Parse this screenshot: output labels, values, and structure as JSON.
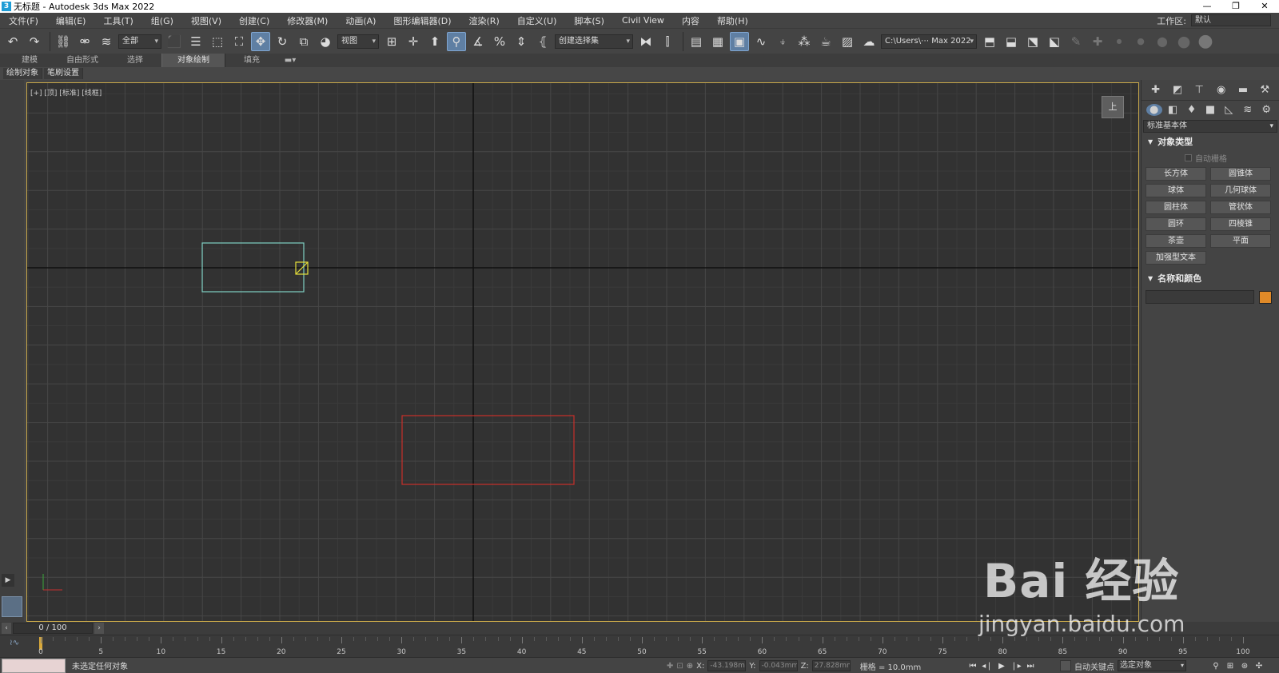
{
  "window": {
    "title": "无标题 - Autodesk 3ds Max 2022",
    "controls": [
      "—",
      "❐",
      "✕"
    ]
  },
  "menu": {
    "items": [
      "文件(F)",
      "编辑(E)",
      "工具(T)",
      "组(G)",
      "视图(V)",
      "创建(C)",
      "修改器(M)",
      "动画(A)",
      "图形编辑器(D)",
      "渲染(R)",
      "自定义(U)",
      "脚本(S)",
      "Civil View",
      "内容",
      "帮助(H)"
    ],
    "workspace_label": "工作区:",
    "workspace_value": "默认"
  },
  "toolbar": {
    "selection_filter": "全部",
    "coord_system": "视图",
    "named_selection": "创建选择集",
    "project_path": "C:\\Users\\⋯ Max 2022"
  },
  "ribbon": {
    "tabs": [
      "建模",
      "自由形式",
      "选择",
      "对象绘制",
      "填充"
    ],
    "active_tab": "对象绘制",
    "panel_items": [
      "绘制对象",
      "笔刷设置"
    ]
  },
  "viewport": {
    "label": "[+] [顶] [标准] [线框]",
    "viewcube_label": "上"
  },
  "command_panel": {
    "category": "标准基本体",
    "object_type_header": "对象类型",
    "autogrid_label": "自动栅格",
    "object_buttons": [
      "长方体",
      "圆锥体",
      "球体",
      "几何球体",
      "圆柱体",
      "管状体",
      "圆环",
      "四棱锥",
      "茶壶",
      "平面",
      "加强型文本"
    ],
    "name_color_header": "名称和颜色",
    "object_color": "#e08a28"
  },
  "timeline": {
    "frame_display": "0 / 100",
    "tick_labels": [
      "0",
      "5",
      "10",
      "15",
      "20",
      "25",
      "30",
      "35",
      "40",
      "45",
      "50",
      "55",
      "60",
      "65",
      "70",
      "75",
      "80",
      "85",
      "90",
      "95",
      "100"
    ]
  },
  "status": {
    "message": "未选定任何对象",
    "x_label": "X:",
    "x_value": "-43.198mm",
    "y_label": "Y:",
    "y_value": "-0.043mm",
    "z_label": "Z:",
    "z_value": "27.828mm",
    "grid_label": "栅格 = 10.0mm",
    "auto_key_label": "自动关键点",
    "selected_mode": "选定对象"
  },
  "watermark": {
    "main": "Bai 经验",
    "sub": "jingyan.baidu.com"
  }
}
